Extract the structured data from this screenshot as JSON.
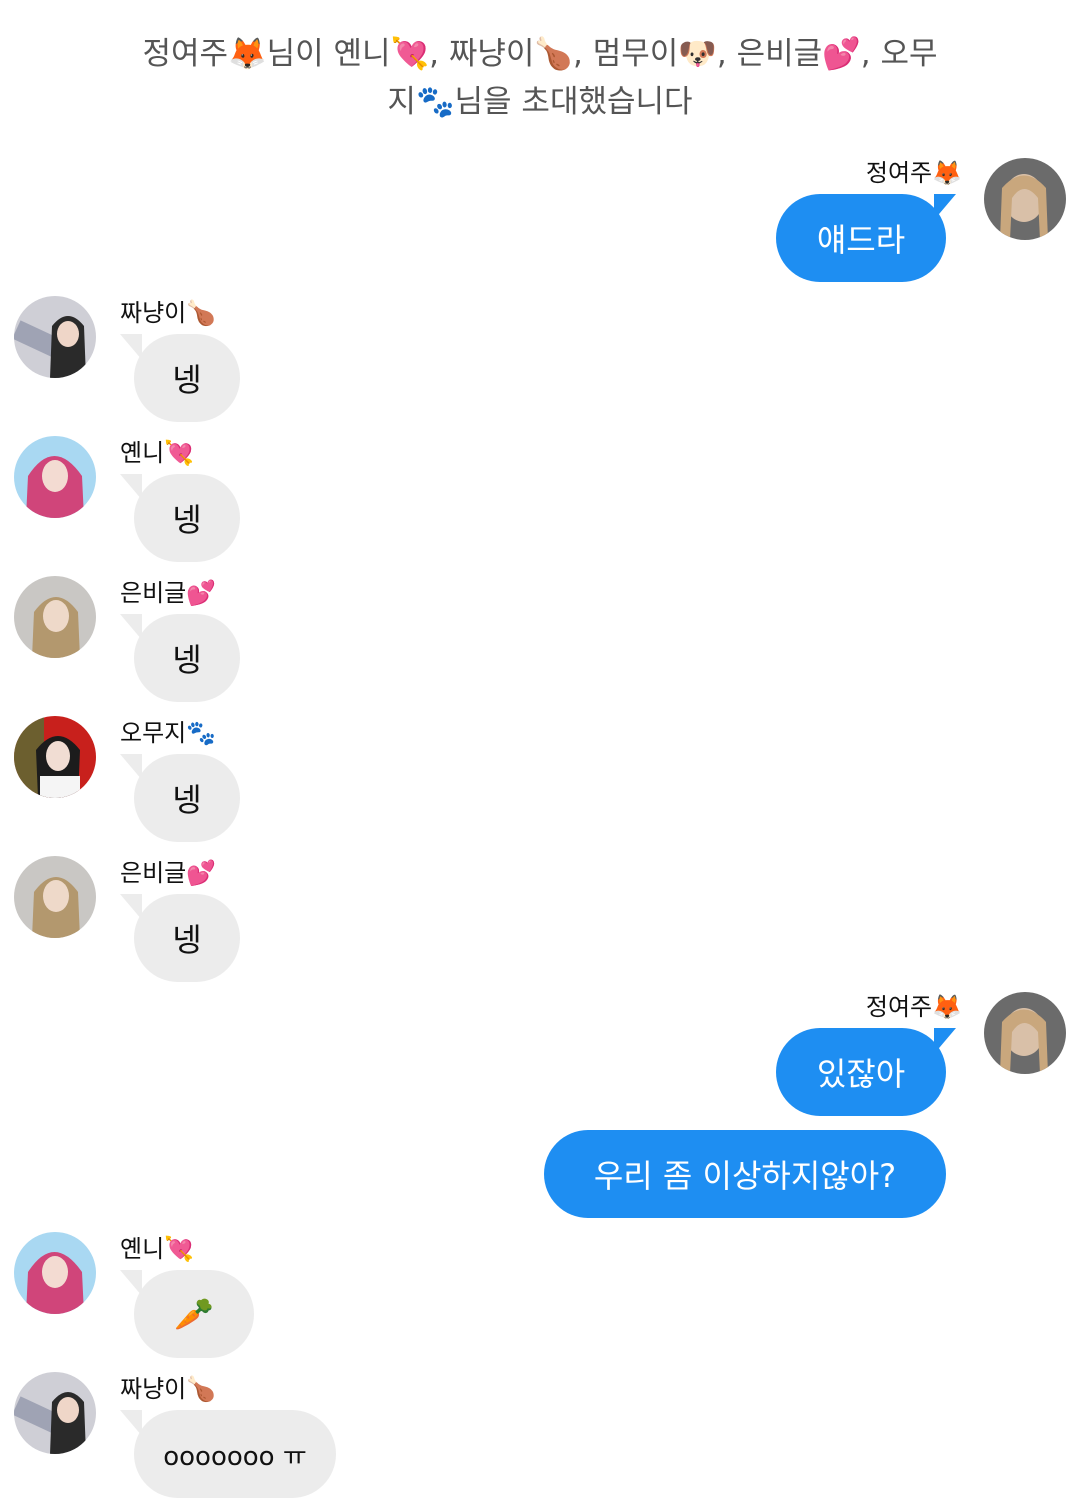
{
  "system_notice": {
    "text": "정여주🦊님이 옌니💘, 짜냥이🍗, 멈무이🐶, 은비글💕, 오무지🐾님을 초대했습니다"
  },
  "users": {
    "jeongyeoju": {
      "name": "정여주🦊",
      "avatar": "hair-portrait-avatar"
    },
    "jjanyang": {
      "name": "짜냥이🍗",
      "avatar": "starpa-portrait-avatar"
    },
    "yenni": {
      "name": "옌니💘",
      "avatar": "pink-hair-portrait-avatar"
    },
    "eunbigeul": {
      "name": "은비글💕",
      "avatar": "brick-wall-portrait-avatar"
    },
    "omuji": {
      "name": "오무지🐾",
      "avatar": "red-background-portrait-avatar"
    }
  },
  "messages": [
    {
      "sender": "정여주🦊",
      "direction": "outgoing",
      "text": "얘드라"
    },
    {
      "sender": "짜냥이🍗",
      "direction": "incoming",
      "text": "넹"
    },
    {
      "sender": "옌니💘",
      "direction": "incoming",
      "text": "넹"
    },
    {
      "sender": "은비글💕",
      "direction": "incoming",
      "text": "넹"
    },
    {
      "sender": "오무지🐾",
      "direction": "incoming",
      "text": "넹"
    },
    {
      "sender": "은비글💕",
      "direction": "incoming",
      "text": "넹"
    },
    {
      "sender": "정여주🦊",
      "direction": "outgoing",
      "text": "있잖아"
    },
    {
      "sender": "정여주🦊",
      "direction": "outgoing",
      "text": "우리 좀 이상하지않아?"
    },
    {
      "sender": "옌니💘",
      "direction": "incoming",
      "text": "🥕"
    },
    {
      "sender": "짜냥이🍗",
      "direction": "incoming",
      "text": "ooooooo ㅠ"
    }
  ],
  "colors": {
    "outgoing_bubble": "#1e8ef2",
    "incoming_bubble": "#ececec",
    "background": "#ffffff"
  }
}
